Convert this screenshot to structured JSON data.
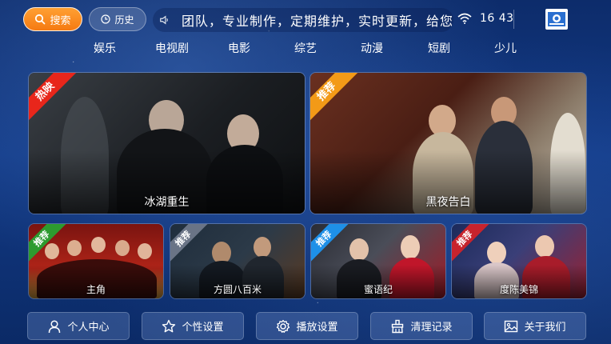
{
  "topbar": {
    "search_label": "搜索",
    "history_label": "历史",
    "marquee_text": "团队，专业制作，定期维护，实时更新，给您",
    "clock": "16 43"
  },
  "categories": [
    "娱乐",
    "电视剧",
    "电影",
    "综艺",
    "动漫",
    "短剧",
    "少儿"
  ],
  "featured": [
    {
      "title": "冰湖重生",
      "badge": "热映",
      "badge_color": "#e8261b"
    },
    {
      "title": "黑夜告白",
      "badge": "推荐",
      "badge_color": "#f39a17"
    }
  ],
  "recommended": [
    {
      "title": "主角",
      "badge": "推荐",
      "badge_color": "#2d9b2f"
    },
    {
      "title": "方圆八百米",
      "badge": "推荐",
      "badge_color": "#6a7486"
    },
    {
      "title": "蜜语纪",
      "badge": "推荐",
      "badge_color": "#1e90e8"
    },
    {
      "title": "度陈美锦",
      "badge": "推荐",
      "badge_color": "#c8232c"
    }
  ],
  "bottom_menu": [
    "个人中心",
    "个性设置",
    "播放设置",
    "清理记录",
    "关于我们"
  ],
  "icons": {
    "search": "search-icon",
    "history": "clock-icon",
    "speaker": "speaker-icon",
    "wifi": "wifi-icon",
    "user": "user-icon",
    "star": "star-icon",
    "gear": "gear-icon",
    "broom": "clean-icon",
    "image": "image-icon"
  }
}
